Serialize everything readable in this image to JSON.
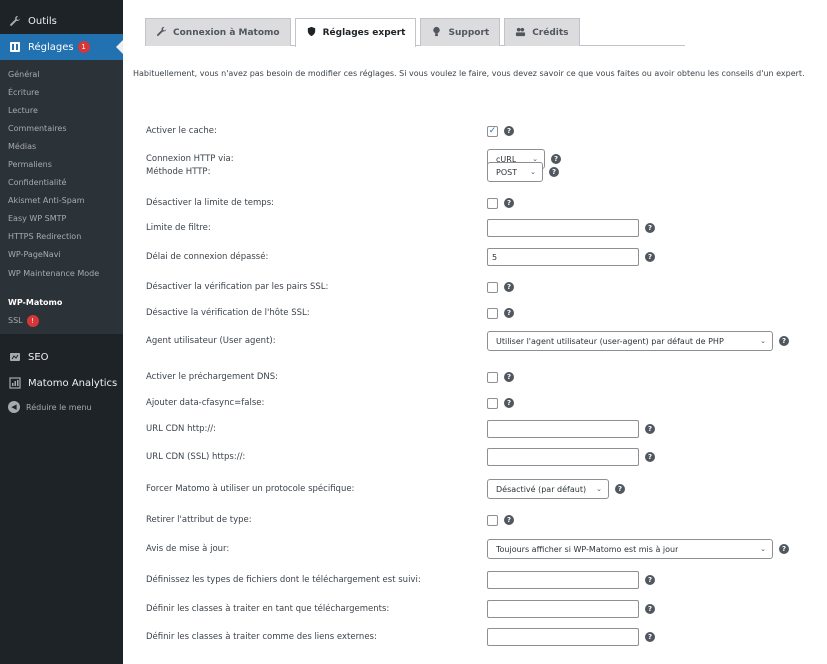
{
  "sidebar": {
    "tools_label": "Outils",
    "settings_label": "Réglages",
    "settings_badge": "1",
    "submenu": [
      {
        "label": "Général"
      },
      {
        "label": "Écriture"
      },
      {
        "label": "Lecture"
      },
      {
        "label": "Commentaires"
      },
      {
        "label": "Médias"
      },
      {
        "label": "Permaliens"
      },
      {
        "label": "Confidentialité"
      },
      {
        "label": "Akismet Anti-Spam"
      },
      {
        "label": "Easy WP SMTP"
      },
      {
        "label": "HTTPS Redirection"
      },
      {
        "label": "WP-PageNavi"
      },
      {
        "label": "WP Maintenance Mode"
      },
      {
        "label": "WP-Matomo"
      },
      {
        "label": "SSL"
      }
    ],
    "ssl_badge": "!",
    "seo_label": "SEO",
    "matomo_label": "Matomo Analytics",
    "reduce_label": "Réduire le menu"
  },
  "tabs": [
    {
      "label": "Connexion à Matomo",
      "icon": "wrench-icon"
    },
    {
      "label": "Réglages expert",
      "icon": "shield-icon"
    },
    {
      "label": "Support",
      "icon": "lightbulb-icon"
    },
    {
      "label": "Crédits",
      "icon": "group-icon"
    }
  ],
  "intro": "Habituellement, vous n'avez pas besoin de modifier ces réglages. Si vous voulez le faire, vous devez savoir ce que vous faites ou avoir obtenu les conseils d'un expert.",
  "settings": [
    {
      "label": "Activer le cache:",
      "type": "checkbox",
      "checked": "✓"
    },
    {
      "label": "Connexion HTTP via:",
      "type": "select",
      "value": "cURL"
    },
    {
      "label": "Méthode HTTP:",
      "type": "select",
      "value": "POST"
    },
    {
      "label": "Désactiver la limite de temps:",
      "type": "checkbox",
      "checked": ""
    },
    {
      "label": "Limite de filtre:",
      "type": "text",
      "value": ""
    },
    {
      "label": "Délai de connexion dépassé:",
      "type": "text",
      "value": "5"
    },
    {
      "label": "Désactiver la vérification par les pairs SSL:",
      "type": "checkbox",
      "checked": ""
    },
    {
      "label": "Désactive la vérification de l'hôte SSL:",
      "type": "checkbox",
      "checked": ""
    },
    {
      "label": "Agent utilisateur (User agent):",
      "type": "select",
      "value": "Utiliser l'agent utilisateur (user-agent) par défaut de PHP"
    },
    {
      "label": "Activer le préchargement DNS:",
      "type": "checkbox",
      "checked": ""
    },
    {
      "label": "Ajouter data-cfasync=false:",
      "type": "checkbox",
      "checked": ""
    },
    {
      "label": "URL CDN http://:",
      "type": "text",
      "value": ""
    },
    {
      "label": "URL CDN (SSL) https://:",
      "type": "text",
      "value": ""
    },
    {
      "label": "Forcer Matomo à utiliser un protocole spécifique:",
      "type": "select",
      "value": "Désactivé (par défaut)"
    },
    {
      "label": "Retirer l'attribut de type:",
      "type": "checkbox",
      "checked": ""
    },
    {
      "label": "Avis de mise à jour:",
      "type": "select",
      "value": "Toujours afficher si WP-Matomo est mis à jour"
    },
    {
      "label": "Définissez les types de fichiers dont le téléchargement est suivi:",
      "type": "text",
      "value": ""
    },
    {
      "label": "Définir les classes à traiter en tant que téléchargements:",
      "type": "text",
      "value": ""
    },
    {
      "label": "Définir les classes à traiter comme des liens externes:",
      "type": "text",
      "value": ""
    }
  ],
  "help_glyph": "?"
}
